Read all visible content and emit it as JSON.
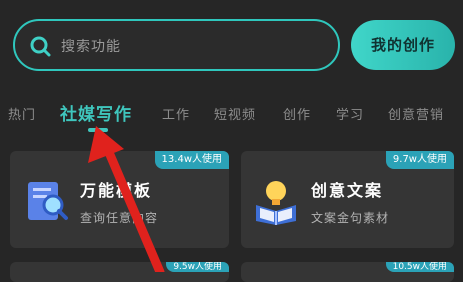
{
  "search": {
    "placeholder": "搜索功能",
    "icon": "search-icon"
  },
  "my_work_button": "我的创作",
  "tabs": [
    "热门",
    "社媒写作",
    "工作",
    "短视频",
    "创作",
    "学习",
    "创意营销"
  ],
  "active_tab": "社媒写作",
  "cards": [
    {
      "title": "万能模板",
      "desc": "查询任意内容",
      "badge": "13.4w人使用",
      "icon": "template-search-icon"
    },
    {
      "title": "创意文案",
      "desc": "文案金句素材",
      "badge": "9.7w人使用",
      "icon": "idea-book-icon"
    },
    {
      "badge": "9.5w人使用"
    },
    {
      "badge": "10.5w人使用"
    }
  ],
  "colors": {
    "accent": "#3fc6bd",
    "badge": "#2ba2b7",
    "background": "#262626",
    "card": "#353535",
    "arrow": "#e0221d"
  }
}
